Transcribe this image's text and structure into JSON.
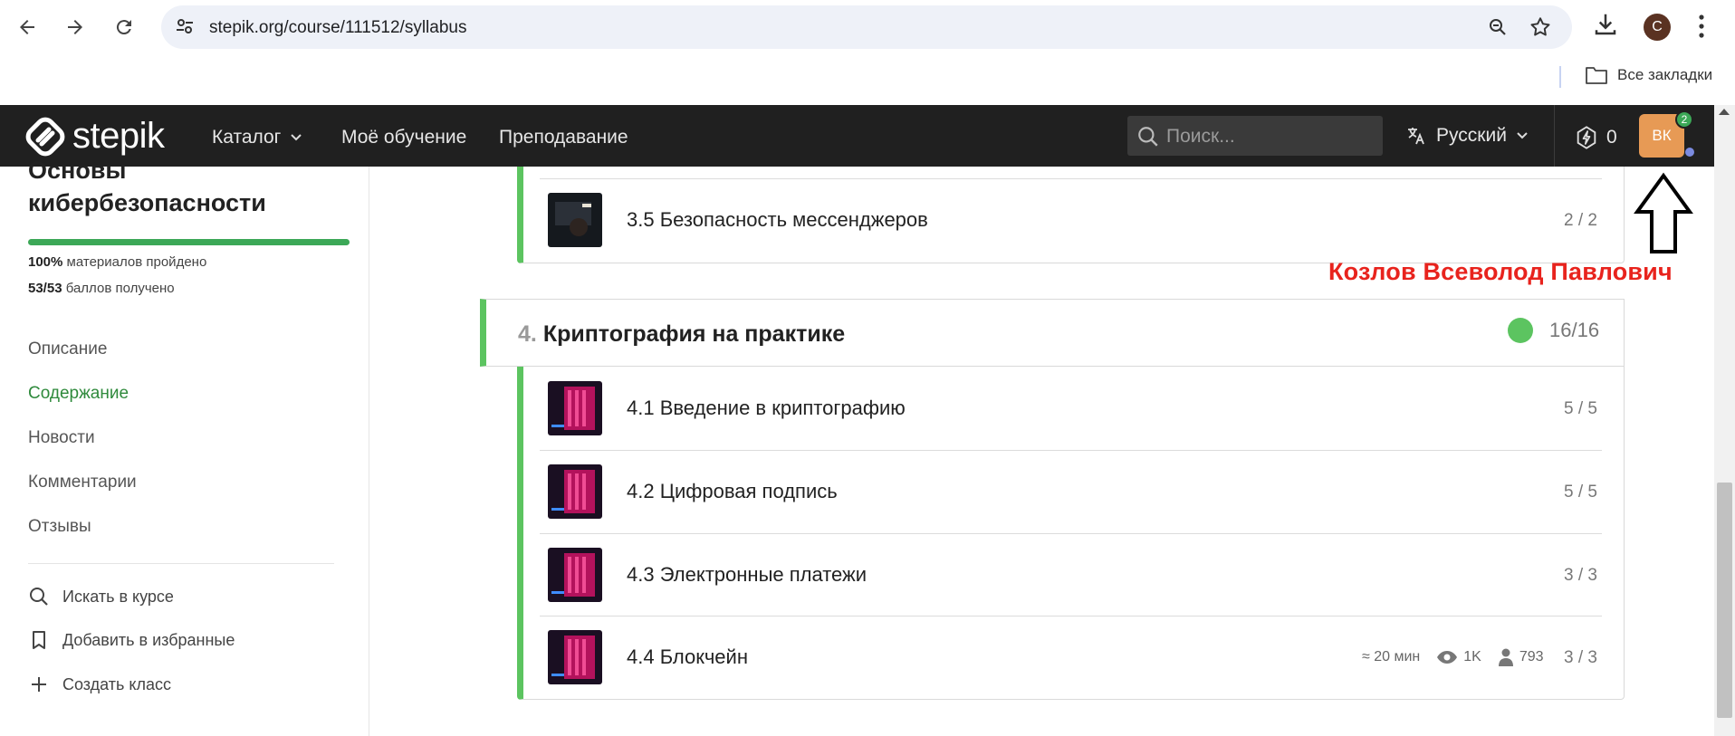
{
  "browser": {
    "url": "stepik.org/course/111512/syllabus",
    "profile_initial": "С",
    "bookmarks_label": "Все закладки"
  },
  "header": {
    "logo_text": "stepik",
    "nav": {
      "catalog": "Каталог",
      "my_learning": "Моё обучение",
      "teaching": "Преподавание"
    },
    "search_placeholder": "Поиск...",
    "language": "Русский",
    "energy_count": "0",
    "avatar_initials": "ВК",
    "notifications_count": "2"
  },
  "sidebar": {
    "course_title": "Основы кибербезопасности",
    "progress": 1.0,
    "materials_pct": "100%",
    "materials_text": "материалов пройдено",
    "points": "53/53",
    "points_text": "баллов получено",
    "links": [
      {
        "label": "Описание",
        "active": false
      },
      {
        "label": "Содержание",
        "active": true
      },
      {
        "label": "Новости",
        "active": false
      },
      {
        "label": "Комментарии",
        "active": false
      },
      {
        "label": "Отзывы",
        "active": false
      }
    ],
    "actions": {
      "search": "Искать в курсе",
      "bookmark": "Добавить в избранные",
      "create_class": "Создать класс"
    }
  },
  "content": {
    "prev_lesson": {
      "title": "3.5 Безопасность мессенджеров",
      "score": "2 / 2"
    },
    "module": {
      "number": "4.",
      "title": "Криптография на практике",
      "score": "16/16",
      "lessons": [
        {
          "title": "4.1 Введение в криптографию",
          "score": "5 / 5"
        },
        {
          "title": "4.2 Цифровая подпись",
          "score": "5 / 5"
        },
        {
          "title": "4.3 Электронные платежи",
          "score": "3 / 3"
        },
        {
          "title": "4.4 Блокчейн",
          "score": "3 / 3",
          "time": "≈ 20 мин",
          "views": "1K",
          "learners": "793"
        }
      ]
    }
  },
  "annotation": {
    "name": "Козлов Всеволод Павлович",
    "color": "#e8231d"
  }
}
